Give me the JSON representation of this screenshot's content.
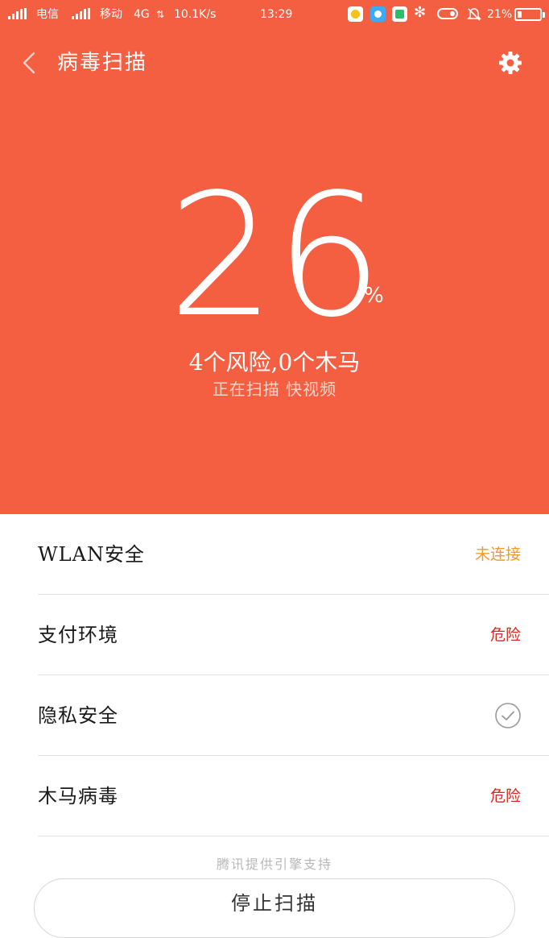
{
  "status_bar": {
    "carrier1": "电信",
    "carrier2": "移动",
    "network": "4G",
    "speed": "10.1K/s",
    "time": "13:29",
    "battery": "21%"
  },
  "header": {
    "title": "病毒扫描",
    "back_icon": "chevron-left-icon",
    "settings_icon": "gear-icon"
  },
  "scan": {
    "percent": "26",
    "percent_sign": "%",
    "progress_fraction": 0.26,
    "summary": "4个风险,0个木马",
    "status_text": "正在扫描 快视频"
  },
  "items": [
    {
      "label": "WLAN安全",
      "status": "未连接",
      "state": "warn"
    },
    {
      "label": "支付环境",
      "status": "危险",
      "state": "danger"
    },
    {
      "label": "隐私安全",
      "status": "",
      "state": "ok"
    },
    {
      "label": "木马病毒",
      "status": "危险",
      "state": "danger"
    }
  ],
  "footer": {
    "credit": "腾讯提供引擎支持",
    "stop_label": "停止扫描"
  },
  "colors": {
    "hero_bg": "#f45f42",
    "warn": "#f19a2a",
    "danger": "#d7281d"
  }
}
